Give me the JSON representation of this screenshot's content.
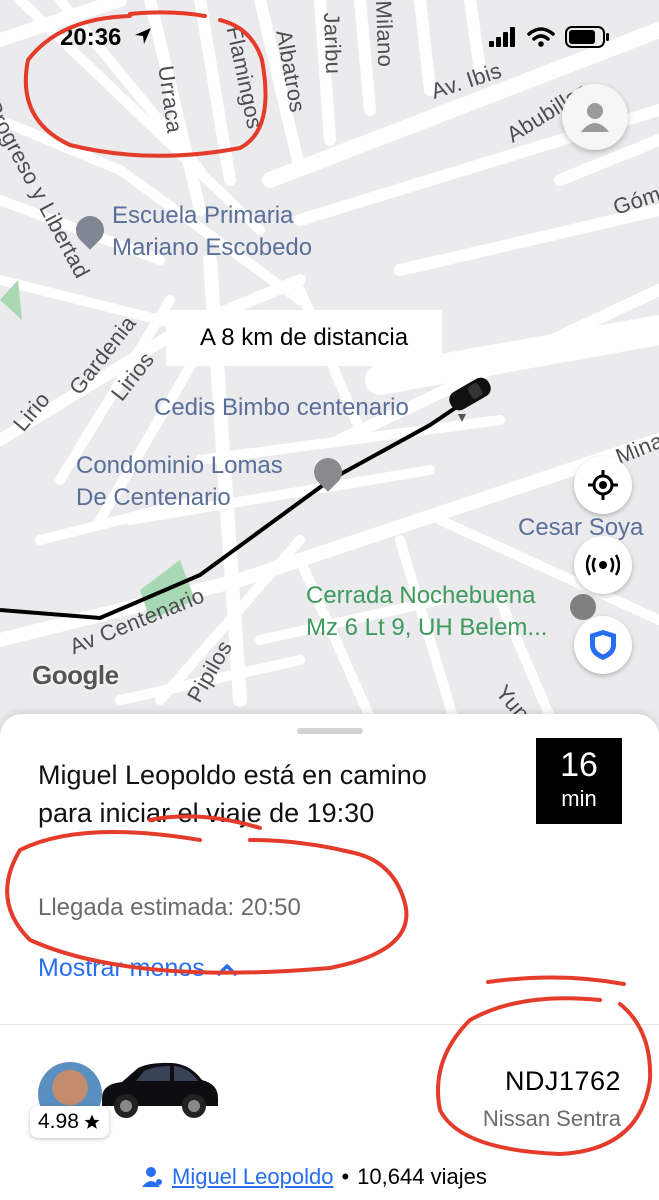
{
  "status_bar": {
    "time": "20:36"
  },
  "map": {
    "streets": [
      "Progreso y Libertad",
      "Urraca",
      "Flamingos",
      "Albatros",
      "Jaribu",
      "Milano",
      "Av. Ibis",
      "Abubillas",
      "Góm",
      "Gardenia",
      "Lirios",
      "Lirio",
      "Minas",
      "Av Centenario",
      "Pipilos",
      "Yun"
    ],
    "pois": {
      "school": "Escuela Primaria\nMariano Escobedo",
      "cedis": "Cedis Bimbo centenario",
      "condominio": "Condominio Lomas\nDe Centenario",
      "cesar": "Cesar Soya",
      "cerrada": "Cerrada Nochebuena\nMz 6 Lt 9, UH Belem..."
    },
    "distance_label": "A 8 km de distancia",
    "google_logo": "Google"
  },
  "trip": {
    "title": "Miguel Leopoldo está en camino para iniciar el viaje de 19:30",
    "eta_value": "16",
    "eta_unit": "min",
    "arrival": "Llegada estimada: 20:50",
    "show_less": "Mostrar menos"
  },
  "driver": {
    "rating": "4.98",
    "plate": "NDJ1762",
    "car_model": "Nissan Sentra",
    "name": "Miguel Leopoldo",
    "separator": "•",
    "trips": "10,644 viajes"
  },
  "colors": {
    "accent_blue": "#276ef1",
    "annotation_red": "#e53b2a",
    "map_bg": "#ebebed"
  }
}
